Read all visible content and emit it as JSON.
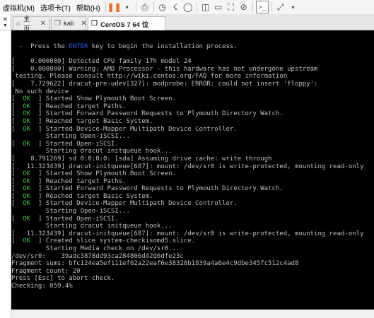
{
  "menu": {
    "items": [
      {
        "label": "虚拟机(M)"
      },
      {
        "label": "选项卡(T)"
      },
      {
        "label": "帮助(H)"
      }
    ]
  },
  "toolbar": {
    "icons": [
      "pause-icon",
      "send-keys-icon",
      "snapshot-icon",
      "revert-snapshot-icon",
      "snapshot-manager-icon",
      "sidebar-view-icon",
      "single-view-icon",
      "fullscreen-icon",
      "unity-icon",
      "console-icon",
      "stretch-icon"
    ]
  },
  "tabs": [
    {
      "label": "主页",
      "icon": "home-icon"
    },
    {
      "label": "kali",
      "icon": "vm-icon"
    },
    {
      "label": "CentOS 7 64 位",
      "icon": "vm-icon",
      "active": true
    }
  ],
  "console": {
    "lines": [
      {
        "parts": [
          {
            "t": "  -  Press the "
          },
          {
            "t": "ENTER",
            "c": "kw"
          },
          {
            "t": " key to begin the installation process."
          }
        ]
      },
      {
        "parts": [
          {
            "t": ""
          }
        ]
      },
      {
        "parts": [
          {
            "t": "[    0.000000] Detected CPU family 17h model 24"
          }
        ]
      },
      {
        "parts": [
          {
            "t": "[    0.000000] Warning: AMD Processor - this hardware has not undergone upstream"
          }
        ]
      },
      {
        "parts": [
          {
            "t": " testing. Please consult http://wiki.centos.org/FAQ for more information"
          }
        ]
      },
      {
        "parts": [
          {
            "t": "[    7.729622] dracut-pre-udev[327]: modprobe: ERROR: could not insert 'floppy':"
          }
        ]
      },
      {
        "parts": [
          {
            "t": " No such device"
          }
        ]
      },
      {
        "parts": [
          {
            "t": "[  "
          },
          {
            "t": "OK",
            "c": "ok"
          },
          {
            "t": "  ] Started Show Plymouth Boot Screen."
          }
        ]
      },
      {
        "parts": [
          {
            "t": "[  "
          },
          {
            "t": "OK",
            "c": "ok"
          },
          {
            "t": "  ] Reached target Paths."
          }
        ]
      },
      {
        "parts": [
          {
            "t": "[  "
          },
          {
            "t": "OK",
            "c": "ok"
          },
          {
            "t": "  ] Started Forward Password Requests to Plymouth Directory Watch."
          }
        ]
      },
      {
        "parts": [
          {
            "t": "[  "
          },
          {
            "t": "OK",
            "c": "ok"
          },
          {
            "t": "  ] Reached target Basic System."
          }
        ]
      },
      {
        "parts": [
          {
            "t": "[  "
          },
          {
            "t": "OK",
            "c": "ok"
          },
          {
            "t": "  ] Started Device-Mapper Multipath Device Controller."
          }
        ]
      },
      {
        "parts": [
          {
            "t": "         Starting Open-iSCSI..."
          }
        ]
      },
      {
        "parts": [
          {
            "t": "[  "
          },
          {
            "t": "OK",
            "c": "ok"
          },
          {
            "t": "  ] Started Open-iSCSI."
          }
        ]
      },
      {
        "parts": [
          {
            "t": "         Starting dracut initqueue hook..."
          }
        ]
      },
      {
        "parts": [
          {
            "t": "[    8.791269] sd 0:0:0:0: [sda] Assuming drive cache: write through"
          }
        ]
      },
      {
        "parts": [
          {
            "t": "[   11.323439] dracut-initqueue[687]: mount: /dev/sr0 is write-protected, mounting read-only"
          }
        ]
      },
      {
        "parts": [
          {
            "t": "[  "
          },
          {
            "t": "OK",
            "c": "ok"
          },
          {
            "t": "  ] Started Show Plymouth Boot Screen."
          }
        ]
      },
      {
        "parts": [
          {
            "t": "[  "
          },
          {
            "t": "OK",
            "c": "ok"
          },
          {
            "t": "  ] Reached target Paths."
          }
        ]
      },
      {
        "parts": [
          {
            "t": "[  "
          },
          {
            "t": "OK",
            "c": "ok"
          },
          {
            "t": "  ] Started Forward Password Requests to Plymouth Directory Watch."
          }
        ]
      },
      {
        "parts": [
          {
            "t": "[  "
          },
          {
            "t": "OK",
            "c": "ok"
          },
          {
            "t": "  ] Reached target Basic System."
          }
        ]
      },
      {
        "parts": [
          {
            "t": "[  "
          },
          {
            "t": "OK",
            "c": "ok"
          },
          {
            "t": "  ] Started Device-Mapper Multipath Device Controller."
          }
        ]
      },
      {
        "parts": [
          {
            "t": "         Starting Open-iSCSI..."
          }
        ]
      },
      {
        "parts": [
          {
            "t": "[  "
          },
          {
            "t": "OK",
            "c": "ok"
          },
          {
            "t": "  ] Started Open-iSCSI."
          }
        ]
      },
      {
        "parts": [
          {
            "t": "         Starting dracut initqueue hook..."
          }
        ]
      },
      {
        "parts": [
          {
            "t": "[   11.323439] dracut-initqueue[687]: mount: /dev/sr0 is write-protected, mounting read-only"
          }
        ]
      },
      {
        "parts": [
          {
            "t": "[  "
          },
          {
            "t": "OK",
            "c": "ok"
          },
          {
            "t": "  ] Created slice system-checkisomd5.slice."
          }
        ]
      },
      {
        "parts": [
          {
            "t": "         Starting Media check on /dev/sr0..."
          }
        ]
      },
      {
        "parts": [
          {
            "t": "/dev/sr0:    39adc3878dd93ca284806d42d6dfe23c"
          }
        ]
      },
      {
        "parts": [
          {
            "t": "Fragment sums: bfc124ea5ef111ef62a22eaf6e38328b1839a4a6e4c9dbe345fc512c4ad8"
          }
        ]
      },
      {
        "parts": [
          {
            "t": "Fragment count: 20"
          }
        ]
      },
      {
        "parts": [
          {
            "t": "Press [Esc] to abort check."
          }
        ]
      },
      {
        "parts": [
          {
            "t": "Checking: 059.4%"
          }
        ]
      }
    ]
  }
}
